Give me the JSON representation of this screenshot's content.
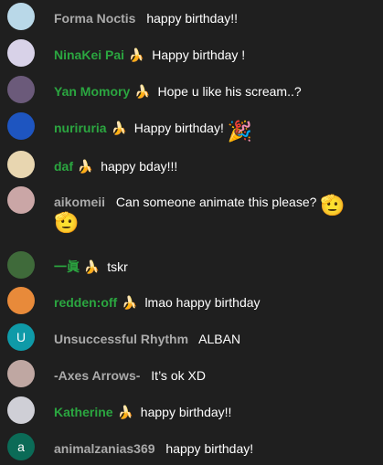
{
  "messages": [
    {
      "author": "Forma Noctis",
      "name_color": "gray",
      "member": false,
      "text": "happy birthday!!",
      "avatar": {
        "bg": "#b9d8e8",
        "letter": ""
      }
    },
    {
      "author": "NinaKei Pai",
      "name_color": "green",
      "member": true,
      "text": "Happy birthday !",
      "avatar": {
        "bg": "#d8d2e8",
        "letter": ""
      }
    },
    {
      "author": "Yan Momory",
      "name_color": "green",
      "member": true,
      "text": "Hope u like his scream..?",
      "avatar": {
        "bg": "#6b5a7a",
        "letter": ""
      }
    },
    {
      "author": "nuriruria",
      "name_color": "green",
      "member": true,
      "text": "Happy birthday!",
      "avatar": {
        "bg": "#1e55c0",
        "letter": ""
      },
      "emoji": "🎉"
    },
    {
      "author": "daf",
      "name_color": "green",
      "member": true,
      "text": "happy bday!!!",
      "avatar": {
        "bg": "#e8d6b0",
        "letter": ""
      }
    },
    {
      "author": "aikomeii",
      "name_color": "gray",
      "member": false,
      "text": "Can someone animate this please?",
      "avatar": {
        "bg": "#caa6a6",
        "letter": ""
      },
      "emoji": "🫡",
      "emoji2": "🫡"
    },
    {
      "author": "一眞",
      "name_color": "green",
      "member": true,
      "text": "tskr",
      "avatar": {
        "bg": "#3f6a3a",
        "letter": ""
      }
    },
    {
      "author": "redden:off",
      "name_color": "green",
      "member": true,
      "text": "lmao happy birthday",
      "avatar": {
        "bg": "#e88a3a",
        "letter": ""
      }
    },
    {
      "author": "Unsuccessful Rhythm",
      "name_color": "gray",
      "member": false,
      "text": "ALBAN",
      "avatar": {
        "bg": "#0f9aa8",
        "letter": "U"
      }
    },
    {
      "author": "-Axes Arrows-",
      "name_color": "gray",
      "member": false,
      "text": "It’s ok XD",
      "avatar": {
        "bg": "#bfa7a2",
        "letter": ""
      }
    },
    {
      "author": "Katherine",
      "name_color": "green",
      "member": true,
      "text": "happy birthday!!",
      "avatar": {
        "bg": "#cfcfd6",
        "letter": ""
      }
    },
    {
      "author": "animalzanias369",
      "name_color": "gray",
      "member": false,
      "text": "happy birthday!",
      "avatar": {
        "bg": "#0b6b57",
        "letter": "a"
      }
    }
  ],
  "icons": {
    "member_badge": "banana-icon"
  }
}
